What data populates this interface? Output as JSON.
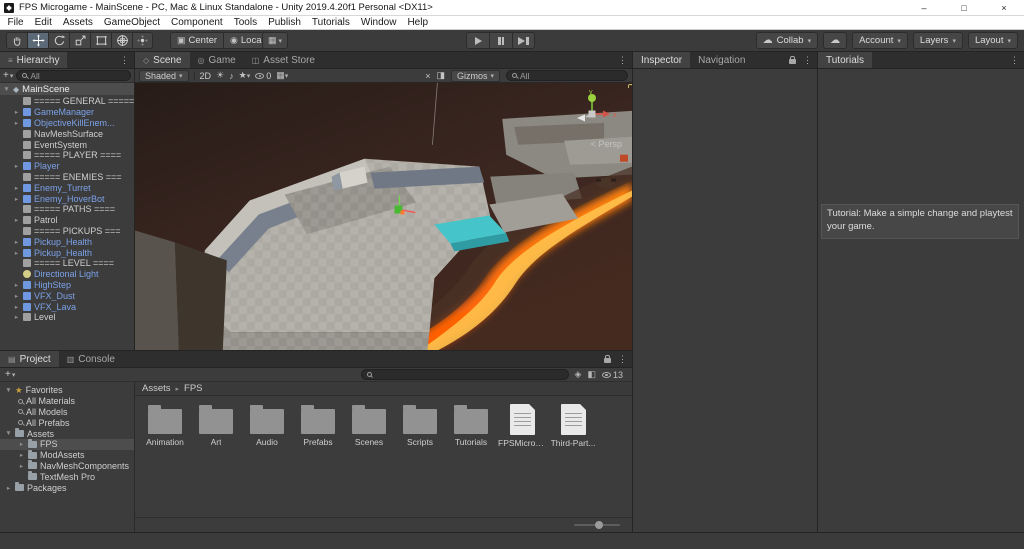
{
  "window": {
    "title": "FPS Microgame - MainScene - PC, Mac & Linux Standalone - Unity 2019.4.20f1 Personal <DX11>",
    "minimize": "–",
    "maximize": "□",
    "close": "×"
  },
  "menu": {
    "items": [
      "File",
      "Edit",
      "Assets",
      "GameObject",
      "Component",
      "Tools",
      "Publish",
      "Tutorials",
      "Window",
      "Help"
    ]
  },
  "toolbar": {
    "pivot": "Center",
    "space": "Local",
    "collab": "Collab",
    "account": "Account",
    "layers": "Layers",
    "layout": "Layout"
  },
  "hierarchy": {
    "tab": "Hierarchy",
    "search": "All",
    "scene_name": "MainScene",
    "items": [
      {
        "label": "===== GENERAL ====="
      },
      {
        "label": "GameManager"
      },
      {
        "label": "ObjectiveKillEnem..."
      },
      {
        "label": "NavMeshSurface"
      },
      {
        "label": "EventSystem"
      },
      {
        "label": "===== PLAYER ===="
      },
      {
        "label": "Player"
      },
      {
        "label": "===== ENEMIES ==="
      },
      {
        "label": "Enemy_Turret"
      },
      {
        "label": "Enemy_HoverBot"
      },
      {
        "label": "===== PATHS ===="
      },
      {
        "label": "Patrol"
      },
      {
        "label": "===== PICKUPS ==="
      },
      {
        "label": "Pickup_Health"
      },
      {
        "label": "Pickup_Health"
      },
      {
        "label": "===== LEVEL ===="
      },
      {
        "label": "Directional Light"
      },
      {
        "label": "HighStep"
      },
      {
        "label": "VFX_Dust"
      },
      {
        "label": "VFX_Lava"
      },
      {
        "label": "Level"
      }
    ]
  },
  "scene_view": {
    "tab_scene": "Scene",
    "tab_game": "Game",
    "tab_store": "Asset Store",
    "shading": "Shaded",
    "mode_2d": "2D",
    "hidden_count": "0",
    "gizmos": "Gizmos",
    "search": "All",
    "projection": "< Persp",
    "axis_x": "x",
    "axis_y": "y"
  },
  "inspector": {
    "tab_inspector": "Inspector",
    "tab_navigation": "Navigation"
  },
  "tutorials": {
    "tab": "Tutorials",
    "message": "Tutorial: Make a simple change and playtest your game."
  },
  "project": {
    "tab_project": "Project",
    "tab_console": "Console",
    "breadcrumb_root": "Assets",
    "breadcrumb_current": "FPS",
    "hidden_count": "13",
    "tree": [
      {
        "label": "Favorites"
      },
      {
        "label": "All Materials"
      },
      {
        "label": "All Models"
      },
      {
        "label": "All Prefabs"
      },
      {
        "label": "Assets"
      },
      {
        "label": "FPS"
      },
      {
        "label": "ModAssets"
      },
      {
        "label": "NavMeshComponents"
      },
      {
        "label": "TextMesh Pro"
      },
      {
        "label": "Packages"
      }
    ],
    "items": [
      {
        "label": "Animation"
      },
      {
        "label": "Art"
      },
      {
        "label": "Audio"
      },
      {
        "label": "Prefabs"
      },
      {
        "label": "Scenes"
      },
      {
        "label": "Scripts"
      },
      {
        "label": "Tutorials"
      },
      {
        "label": "FPSMicrog..."
      },
      {
        "label": "Third-Part..."
      }
    ]
  }
}
